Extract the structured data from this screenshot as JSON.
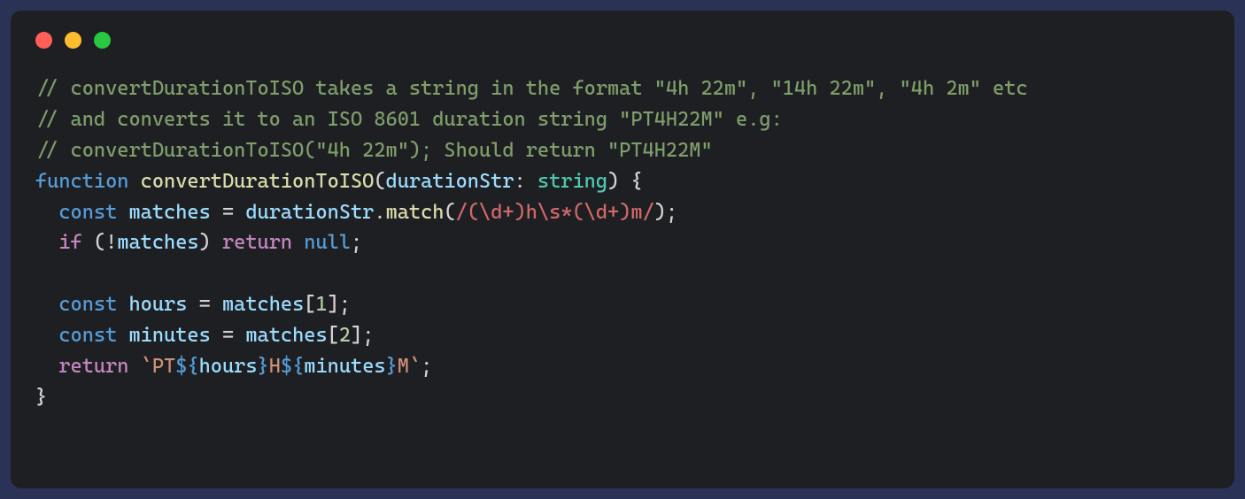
{
  "window": {
    "traffic_lights": [
      "close",
      "minimize",
      "maximize"
    ]
  },
  "code": {
    "language": "typescript",
    "lines": [
      {
        "tokens": [
          {
            "t": "// convertDurationToISO takes a string in the format \"4h 22m\", \"14h 22m\", \"4h 2m\" etc",
            "c": "tok-comment"
          }
        ]
      },
      {
        "tokens": [
          {
            "t": "// and converts it to an ISO 8601 duration string \"PT4H22M\" e.g:",
            "c": "tok-comment"
          }
        ]
      },
      {
        "tokens": [
          {
            "t": "// convertDurationToISO(\"4h 22m\"); Should return \"PT4H22M\"",
            "c": "tok-comment"
          }
        ]
      },
      {
        "tokens": [
          {
            "t": "function",
            "c": "tok-keyword"
          },
          {
            "t": " ",
            "c": ""
          },
          {
            "t": "convertDurationToISO",
            "c": "tok-fn"
          },
          {
            "t": "(",
            "c": "tok-punct"
          },
          {
            "t": "durationStr",
            "c": "tok-var"
          },
          {
            "t": ": ",
            "c": "tok-punct"
          },
          {
            "t": "string",
            "c": "tok-type"
          },
          {
            "t": ") {",
            "c": "tok-punct"
          }
        ]
      },
      {
        "tokens": [
          {
            "t": "  ",
            "c": ""
          },
          {
            "t": "const",
            "c": "tok-keyword"
          },
          {
            "t": " ",
            "c": ""
          },
          {
            "t": "matches",
            "c": "tok-var"
          },
          {
            "t": " = ",
            "c": "tok-punct"
          },
          {
            "t": "durationStr",
            "c": "tok-var"
          },
          {
            "t": ".",
            "c": "tok-punct"
          },
          {
            "t": "match",
            "c": "tok-fn"
          },
          {
            "t": "(",
            "c": "tok-punct"
          },
          {
            "t": "/(\\d+)h\\s*(\\d+)m/",
            "c": "tok-regex"
          },
          {
            "t": ");",
            "c": "tok-punct"
          }
        ]
      },
      {
        "tokens": [
          {
            "t": "  ",
            "c": ""
          },
          {
            "t": "if",
            "c": "tok-keyword2"
          },
          {
            "t": " (!",
            "c": "tok-punct"
          },
          {
            "t": "matches",
            "c": "tok-var"
          },
          {
            "t": ") ",
            "c": "tok-punct"
          },
          {
            "t": "return",
            "c": "tok-keyword2"
          },
          {
            "t": " ",
            "c": ""
          },
          {
            "t": "null",
            "c": "tok-keyword"
          },
          {
            "t": ";",
            "c": "tok-punct"
          }
        ]
      },
      {
        "tokens": [
          {
            "t": "",
            "c": ""
          }
        ]
      },
      {
        "tokens": [
          {
            "t": "  ",
            "c": ""
          },
          {
            "t": "const",
            "c": "tok-keyword"
          },
          {
            "t": " ",
            "c": ""
          },
          {
            "t": "hours",
            "c": "tok-var"
          },
          {
            "t": " = ",
            "c": "tok-punct"
          },
          {
            "t": "matches",
            "c": "tok-var"
          },
          {
            "t": "[",
            "c": "tok-punct"
          },
          {
            "t": "1",
            "c": "tok-num"
          },
          {
            "t": "];",
            "c": "tok-punct"
          }
        ]
      },
      {
        "tokens": [
          {
            "t": "  ",
            "c": ""
          },
          {
            "t": "const",
            "c": "tok-keyword"
          },
          {
            "t": " ",
            "c": ""
          },
          {
            "t": "minutes",
            "c": "tok-var"
          },
          {
            "t": " = ",
            "c": "tok-punct"
          },
          {
            "t": "matches",
            "c": "tok-var"
          },
          {
            "t": "[",
            "c": "tok-punct"
          },
          {
            "t": "2",
            "c": "tok-num"
          },
          {
            "t": "];",
            "c": "tok-punct"
          }
        ]
      },
      {
        "tokens": [
          {
            "t": "  ",
            "c": ""
          },
          {
            "t": "return",
            "c": "tok-keyword2"
          },
          {
            "t": " ",
            "c": ""
          },
          {
            "t": "`",
            "c": "tok-str"
          },
          {
            "t": "PT",
            "c": "tok-str"
          },
          {
            "t": "${",
            "c": "tok-templ"
          },
          {
            "t": "hours",
            "c": "tok-var"
          },
          {
            "t": "}",
            "c": "tok-templ"
          },
          {
            "t": "H",
            "c": "tok-str"
          },
          {
            "t": "${",
            "c": "tok-templ"
          },
          {
            "t": "minutes",
            "c": "tok-var"
          },
          {
            "t": "}",
            "c": "tok-templ"
          },
          {
            "t": "M",
            "c": "tok-str"
          },
          {
            "t": "`",
            "c": "tok-str"
          },
          {
            "t": ";",
            "c": "tok-punct"
          }
        ]
      },
      {
        "tokens": [
          {
            "t": "}",
            "c": "tok-punct"
          }
        ]
      }
    ]
  }
}
